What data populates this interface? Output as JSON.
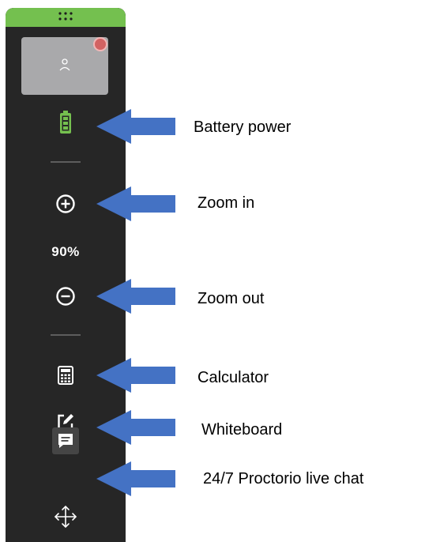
{
  "toolbar": {
    "zoom_level": "90%",
    "colors": {
      "accent": "#74c04f",
      "panel": "#262626",
      "battery": "#75c04f",
      "record": "#d26262",
      "arrow": "#4472c4"
    },
    "icons": [
      "drag-handle-icon",
      "avatar-icon",
      "battery-icon",
      "zoom-in-icon",
      "zoom-out-icon",
      "calculator-icon",
      "whiteboard-icon",
      "chat-icon",
      "move-icon"
    ]
  },
  "annotations": {
    "battery": "Battery power",
    "zoom_in": "Zoom in",
    "zoom_out": "Zoom out",
    "calculator": "Calculator",
    "whiteboard": "Whiteboard",
    "chat": "24/7 Proctorio live chat"
  }
}
